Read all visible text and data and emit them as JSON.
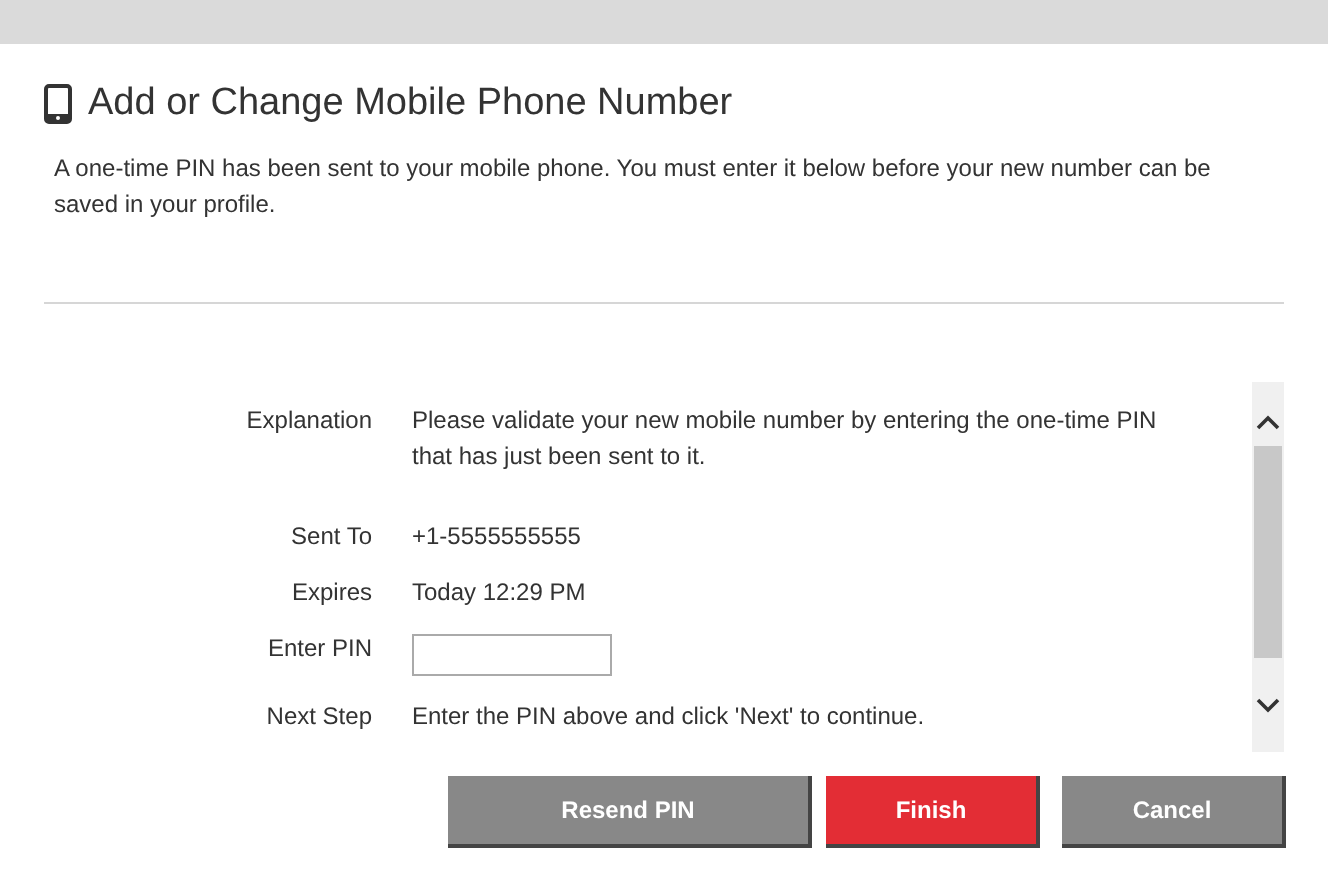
{
  "dialog": {
    "title": "Add or Change Mobile Phone Number",
    "description": "A one-time PIN has been sent to your mobile phone. You must enter it below before your new number can be saved in your profile."
  },
  "fields": [
    {
      "kind": "text",
      "label": "Explanation",
      "value": "Please validate your new mobile number by entering the one-time PIN that has just been sent to it."
    },
    {
      "kind": "text",
      "label": "Sent To",
      "value": "+1-5555555555"
    },
    {
      "kind": "text",
      "label": "Expires",
      "value": "Today 12:29 PM"
    },
    {
      "kind": "input",
      "label": "Enter PIN"
    },
    {
      "kind": "text",
      "label": "Next Step",
      "value": "Enter the PIN above and click 'Next' to continue."
    }
  ],
  "buttons": [
    {
      "kind": "secondary",
      "label": "Resend PIN"
    },
    {
      "kind": "primary",
      "label": "Finish"
    },
    {
      "kind": "secondary",
      "label": "Cancel"
    }
  ]
}
